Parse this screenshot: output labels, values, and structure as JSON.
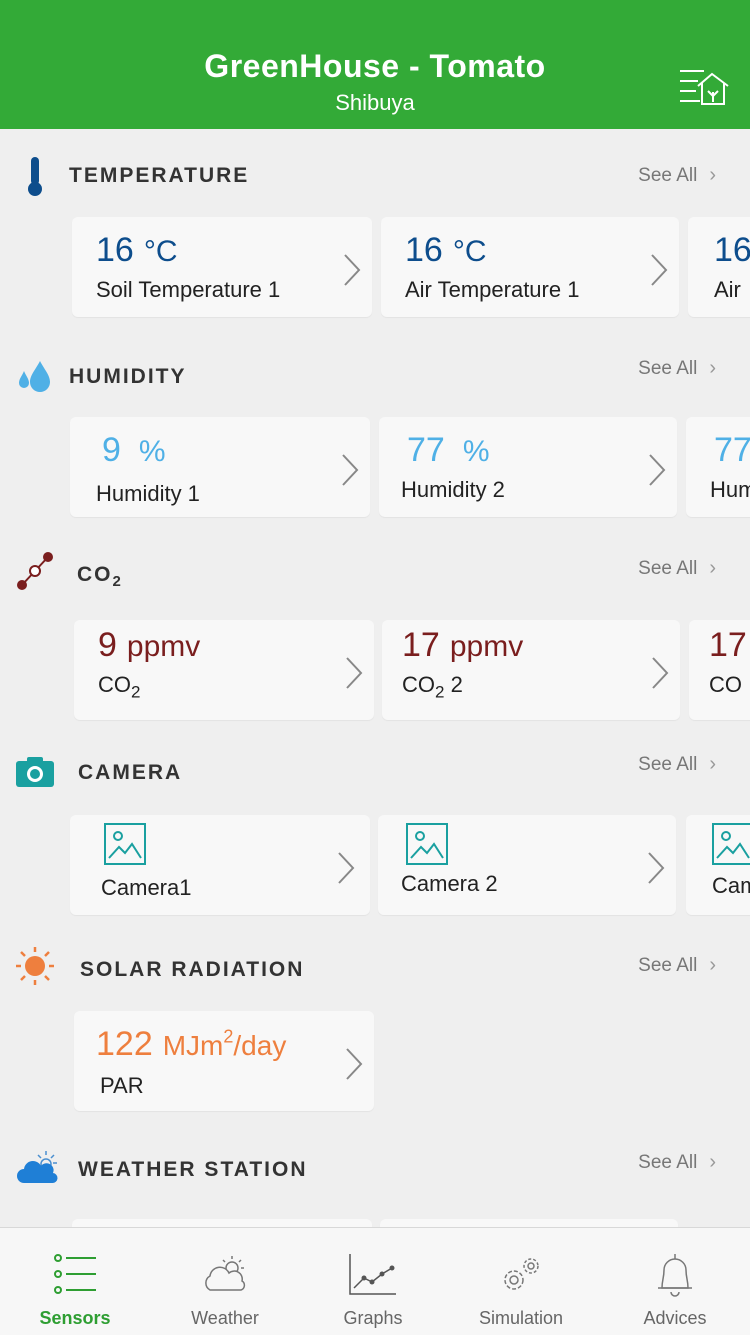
{
  "header": {
    "title": "GreenHouse - Tomato",
    "subtitle": "Shibuya",
    "menu_icon": "greenhouse-list-icon"
  },
  "colors": {
    "brand": "#33aa37",
    "temperature": "#0d4d8c",
    "humidity": "#4fb0e6",
    "co2": "#7a1e1e",
    "camera": "#1aa0a0",
    "solar": "#ee7f3e"
  },
  "see_all": "See All",
  "sections": {
    "temperature": {
      "title": "TEMPERATURE",
      "icon": "thermometer-icon",
      "cards": [
        {
          "value": "16",
          "unit": "°C",
          "label": "Soil Temperature 1"
        },
        {
          "value": "16",
          "unit": "°C",
          "label": "Air Temperature 1"
        },
        {
          "value": "16",
          "unit": "",
          "label": "Air"
        }
      ]
    },
    "humidity": {
      "title": "HUMIDITY",
      "icon": "water-drops-icon",
      "cards": [
        {
          "value": "9",
          "unit": "%",
          "label": "Humidity 1"
        },
        {
          "value": "77",
          "unit": "%",
          "label": "Humidity 2"
        },
        {
          "value": "77",
          "unit": "",
          "label": "Hum"
        }
      ]
    },
    "co2": {
      "title": "CO",
      "title_sub": "2",
      "icon": "molecule-icon",
      "cards": [
        {
          "value": "9",
          "unit": "ppmv",
          "label": "CO",
          "label_sub": "2",
          "label_suffix": ""
        },
        {
          "value": "17",
          "unit": "ppmv",
          "label": "CO",
          "label_sub": "2",
          "label_suffix": " 2"
        },
        {
          "value": "17",
          "unit": "",
          "label": "CO",
          "label_sub": "",
          "label_suffix": ""
        }
      ]
    },
    "camera": {
      "title": "CAMERA",
      "icon": "camera-icon",
      "cards": [
        {
          "label": "Camera1",
          "image_icon": "image-icon"
        },
        {
          "label": "Camera 2",
          "image_icon": "image-icon"
        },
        {
          "label": "Cam",
          "image_icon": "image-icon"
        }
      ]
    },
    "solar": {
      "title": "SOLAR RADIATION",
      "icon": "sun-icon",
      "cards": [
        {
          "value": "122",
          "unit": "MJm",
          "unit_sup": "2",
          "unit_suffix": "/day",
          "label": "PAR"
        }
      ]
    },
    "weather": {
      "title": "WEATHER STATION",
      "icon": "cloud-sun-icon"
    }
  },
  "tabs": [
    {
      "label": "Sensors",
      "icon": "sensors-list-icon",
      "active": true
    },
    {
      "label": "Weather",
      "icon": "cloud-sun-icon",
      "active": false
    },
    {
      "label": "Graphs",
      "icon": "line-graph-icon",
      "active": false
    },
    {
      "label": "Simulation",
      "icon": "gears-icon",
      "active": false
    },
    {
      "label": "Advices",
      "icon": "bell-icon",
      "active": false
    }
  ]
}
